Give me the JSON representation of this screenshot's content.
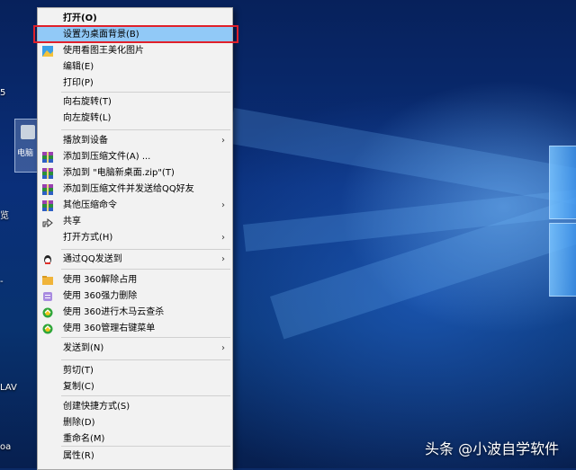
{
  "desktop": {
    "left_labels": [
      "5",
      "览",
      "-",
      "LAV",
      "oa"
    ],
    "icon_label": "电脑"
  },
  "menu": {
    "items": [
      {
        "label": "打开(O)",
        "bold": true
      },
      {
        "label": "设置为桌面背景(B)",
        "highlighted": true
      },
      {
        "label": "使用看图王美化图片",
        "icon": "picture-icon"
      },
      {
        "label": "编辑(E)"
      },
      {
        "label": "打印(P)"
      },
      {
        "label": "向右旋转(T)"
      },
      {
        "label": "向左旋转(L)"
      },
      {
        "label": "播放到设备",
        "submenu": true
      },
      {
        "label": "添加到压缩文件(A) ...",
        "icon": "archive-icon"
      },
      {
        "label": "添加到 \"电脑新桌面.zip\"(T)",
        "icon": "archive-icon"
      },
      {
        "label": "添加到压缩文件并发送给QQ好友",
        "icon": "archive-icon"
      },
      {
        "label": "其他压缩命令",
        "icon": "archive-icon",
        "submenu": true
      },
      {
        "label": "共享",
        "icon": "share-icon"
      },
      {
        "label": "打开方式(H)",
        "submenu": true
      },
      {
        "label": "通过QQ发送到",
        "icon": "qq-icon",
        "submenu": true
      },
      {
        "label": "使用 360解除占用",
        "icon": "folder-icon"
      },
      {
        "label": "使用 360强力删除",
        "icon": "shredder-icon"
      },
      {
        "label": "使用 360进行木马云查杀",
        "icon": "shield-360-icon"
      },
      {
        "label": "使用 360管理右键菜单",
        "icon": "shield-360-icon"
      },
      {
        "label": "发送到(N)",
        "submenu": true
      },
      {
        "label": "剪切(T)"
      },
      {
        "label": "复制(C)"
      },
      {
        "label": "创建快捷方式(S)"
      },
      {
        "label": "删除(D)"
      },
      {
        "label": "重命名(M)"
      },
      {
        "label": "属性(R)"
      }
    ],
    "submenu_arrow": "›"
  },
  "watermark": "头条 @小波自学软件",
  "colors": {
    "highlight": "#91c9f7",
    "annotation_box": "#e0202a"
  }
}
